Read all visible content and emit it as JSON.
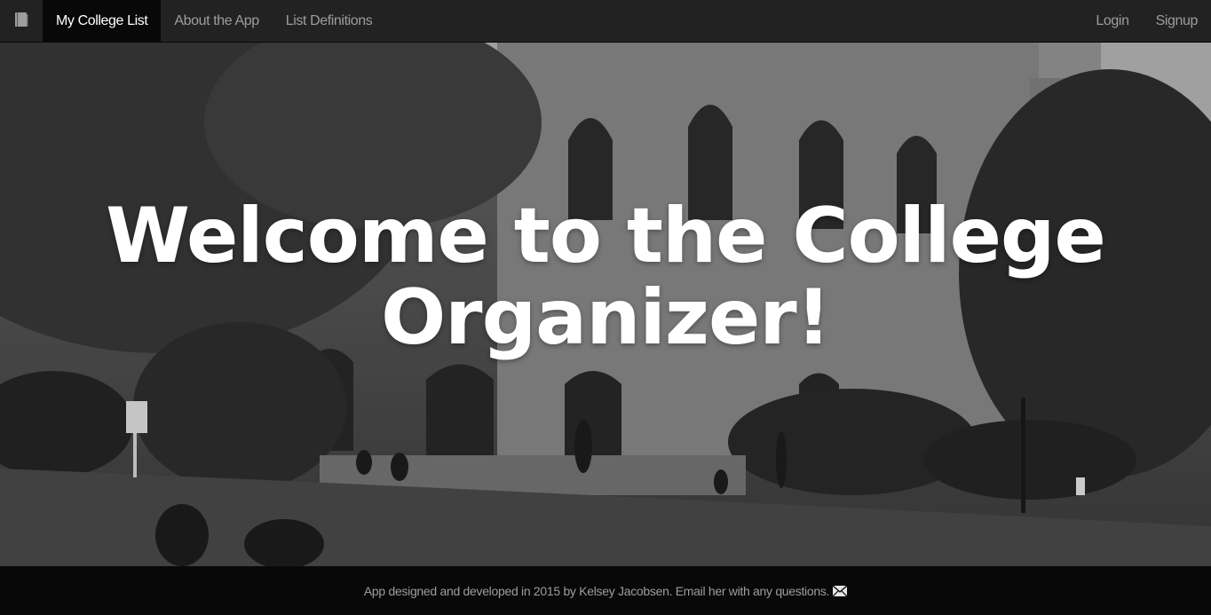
{
  "navbar": {
    "brand_icon": "book-icon",
    "left_items": [
      {
        "label": "My College List",
        "active": true
      },
      {
        "label": "About the App",
        "active": false
      },
      {
        "label": "List Definitions",
        "active": false
      }
    ],
    "right_items": [
      {
        "label": "Login"
      },
      {
        "label": "Signup"
      }
    ]
  },
  "hero": {
    "title_line1": "Welcome to the College",
    "title_line2": "Organizer!",
    "background": "grayscale campus photo"
  },
  "footer": {
    "text": "App designed and developed in 2015 by Kelsey Jacobsen. Email her with any questions.",
    "mail_icon": "envelope-icon"
  },
  "colors": {
    "navbar_bg": "#222222",
    "navbar_active_bg": "#080808",
    "nav_text": "#9d9d9d",
    "footer_bg": "#080808",
    "title_color": "#ffffff"
  }
}
